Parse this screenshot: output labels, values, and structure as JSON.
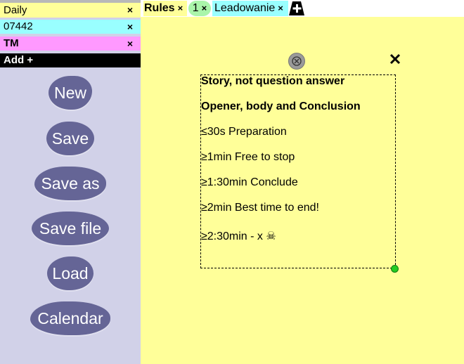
{
  "sidebar": {
    "notes": [
      {
        "label": "Daily",
        "close": "×",
        "color": "#ffff99"
      },
      {
        "label": "07442",
        "close": "×",
        "color": "#99ffff"
      },
      {
        "label": "TM",
        "close": "×",
        "color": "#ff99ff"
      }
    ],
    "add_label": "Add +",
    "buttons": [
      "New",
      "Save",
      "Save as",
      "Save file",
      "Load",
      "Calendar"
    ]
  },
  "tabs": [
    {
      "label": "Rules",
      "close": "×",
      "color": "#ffff99",
      "active": true
    },
    {
      "label": "1",
      "close": "×",
      "color": "#aaf5aa"
    },
    {
      "label": "Leadowanie",
      "close": "×",
      "color": "#99ffff"
    }
  ],
  "add_tab_icon": "plus-tab-icon",
  "note": {
    "lines": [
      "Story, not question answer",
      "Opener, body and Conclusion",
      "≤30s Preparation",
      "≥1min Free to stop",
      "≥1:30min Conclude",
      "≥2min Best time to end!",
      "≥2:30min - x ☠"
    ]
  }
}
